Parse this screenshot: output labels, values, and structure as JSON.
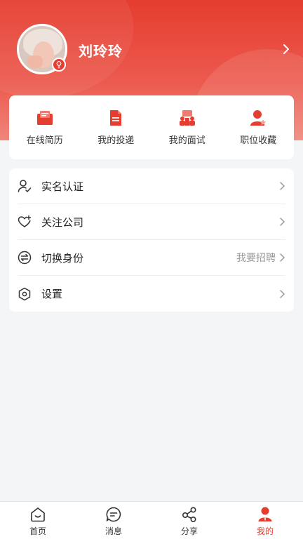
{
  "profile": {
    "name": "刘玲玲",
    "gender_symbol": "♀"
  },
  "quick_actions": [
    {
      "label": "在线简历",
      "icon": "resume-icon"
    },
    {
      "label": "我的投递",
      "icon": "document-icon"
    },
    {
      "label": "我的面试",
      "icon": "interview-icon"
    },
    {
      "label": "职位收藏",
      "icon": "favorite-user-icon"
    }
  ],
  "menu": [
    {
      "label": "实名认证",
      "icon": "user-verify-icon",
      "extra": ""
    },
    {
      "label": "关注公司",
      "icon": "heart-plus-icon",
      "extra": ""
    },
    {
      "label": "切换身份",
      "icon": "switch-icon",
      "extra": "我要招聘"
    },
    {
      "label": "设置",
      "icon": "hexagon-settings-icon",
      "extra": ""
    }
  ],
  "tabbar": [
    {
      "label": "首页",
      "icon": "home-icon",
      "active": false
    },
    {
      "label": "消息",
      "icon": "message-icon",
      "active": false
    },
    {
      "label": "分享",
      "icon": "share-icon",
      "active": false
    },
    {
      "label": "我的",
      "icon": "profile-icon",
      "active": true
    }
  ],
  "colors": {
    "accent": "#e53d2f",
    "background": "#f4f5f7"
  }
}
